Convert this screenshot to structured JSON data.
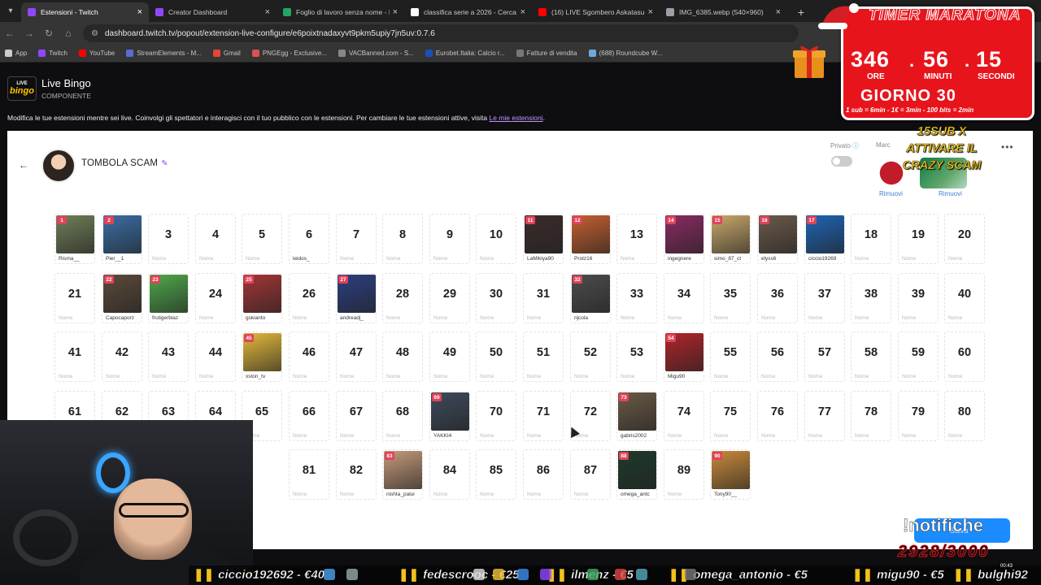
{
  "browser": {
    "tabs": [
      {
        "title": "Estensioni - Twitch",
        "color": "#9147ff",
        "active": true
      },
      {
        "title": "Creator Dashboard",
        "color": "#9147ff",
        "active": false
      },
      {
        "title": "Foglio di lavoro senza nome - F",
        "color": "#23a566",
        "active": false
      },
      {
        "title": "classifica serie a 2026 - Cerca c",
        "color": "#ffffff",
        "active": false
      },
      {
        "title": "(16) LIVE Sgombero Askatasuna",
        "color": "#ff0000",
        "active": false
      },
      {
        "title": "IMG_6385.webp (540×960)",
        "color": "#9aa0a6",
        "active": false
      }
    ],
    "url": "dashboard.twitch.tv/popout/extension-live-configure/e6poixtnadaxyvt9pkm5upiy7jn5uv:0.7.6",
    "bookmarks": [
      {
        "label": "App",
        "color": "#cccccc"
      },
      {
        "label": "Twitch",
        "color": "#9147ff"
      },
      {
        "label": "YouTube",
        "color": "#ff0000"
      },
      {
        "label": "StreamElements - M...",
        "color": "#5b6bd6"
      },
      {
        "label": "Gmail",
        "color": "#ea4335"
      },
      {
        "label": "PNGEgg - Exclusive...",
        "color": "#d9534f"
      },
      {
        "label": "VACBanned.com - S...",
        "color": "#888888"
      },
      {
        "label": "Eurobet.Italia: Calcio r...",
        "color": "#1d4fb8"
      },
      {
        "label": "Fatture di vendita",
        "color": "#777777"
      },
      {
        "label": "(688) Roundcube W...",
        "color": "#6fa8dc"
      }
    ]
  },
  "header": {
    "logo_line1": "LIVE",
    "logo_line2": "bingo",
    "extension_name": "Live Bingo",
    "extension_type": "COMPONENTE",
    "description": "Modifica le tue estensioni mentre sei live. Coinvolgi gli spettatori e interagisci con il tuo pubblico con le estensioni. Per cambiare le tue estensioni attive, visita ",
    "description_link": "Le mie estensioni",
    "description_end": "."
  },
  "card": {
    "title": "TOMBOLA SCAM",
    "private_label": "Privato",
    "mark_label": "Marc",
    "remove_1": "Rimuovi",
    "remove_2": "Rimuovi",
    "name_placeholder": "Nome",
    "cells": {
      "1": {
        "name": "Risma__",
        "color": "#6f7e58"
      },
      "2": {
        "name": "Pier__1",
        "color": "#3a6ea5"
      },
      "6": {
        "name": "leidos_",
        "plain": true
      },
      "11": {
        "name": "LaMikiya90",
        "color": "#3b2b2b"
      },
      "12": {
        "name": "Protz16",
        "color": "#c4602e"
      },
      "14": {
        "name": "ingegnere",
        "color": "#8a2a62"
      },
      "15": {
        "name": "simo_87_ct",
        "color": "#c9a86a"
      },
      "16": {
        "name": "elyss6",
        "color": "#6b5a4a"
      },
      "17": {
        "name": "ciccio19269",
        "color": "#1e64b4"
      },
      "22": {
        "name": "Capocaporz",
        "color": "#5b4a3a"
      },
      "23": {
        "name": "frutigerbiaz",
        "color": "#4fa84a"
      },
      "25": {
        "name": "gskianto",
        "color": "#a33535"
      },
      "27": {
        "name": "andreadj_",
        "color": "#2c3f80"
      },
      "32": {
        "name": "njcola",
        "color": "#4c4c4c"
      },
      "45": {
        "name": "xston_tv",
        "color": "#e3b93a"
      },
      "54": {
        "name": "Migu90",
        "color": "#b0242a"
      },
      "69": {
        "name": "YAKKI4",
        "color": "#3d4a5a"
      },
      "73": {
        "name": "gabris2002",
        "color": "#6a5a45"
      },
      "83": {
        "name": "nishta_palui",
        "color": "#c59a7a"
      },
      "88": {
        "name": "omega_antc",
        "color": "#1e3a2a"
      },
      "90": {
        "name": "Tony90__",
        "color": "#c98a3a"
      }
    }
  },
  "overlay": {
    "timer_title": "TIMER MARATONA",
    "hours": "346",
    "minutes": "56",
    "seconds": "15",
    "hours_label": "ORE",
    "minutes_label": "MINUTI",
    "seconds_label": "SECONDI",
    "day": "GIORNO 30",
    "rules": "1 sub = 6min - 1€ = 3min - 100 bits = 2min",
    "subs_text_1": "15SUB X",
    "subs_text_2": "ATTIVARE IL",
    "subs_text_3": "CRAZY SCAM",
    "notifiche": "!notifiche",
    "notifiche_sub": "Salva",
    "goal": "2928/3000",
    "ticker": [
      {
        "text": "ciccio192692 - €40",
        "emoji": "🏆"
      },
      {
        "text": "fedescrooc - €25",
        "emoji": "🏆"
      },
      {
        "text": "ilmenz - €5",
        "emoji": "🏆"
      },
      {
        "text": "omega_antonio - €5",
        "emoji": "🏆"
      },
      {
        "text": "migu90 - €5",
        "emoji": "🏆"
      },
      {
        "text": "bulghi92",
        "emoji": "🏆"
      }
    ],
    "clock": "00:43"
  }
}
